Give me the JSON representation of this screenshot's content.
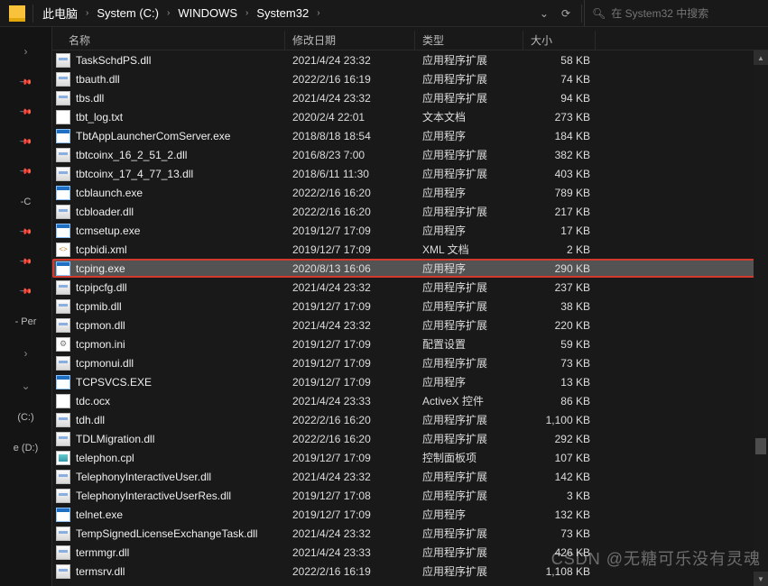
{
  "breadcrumb": [
    "此电脑",
    "System (C:)",
    "WINDOWS",
    "System32"
  ],
  "search": {
    "placeholder": "在 System32 中搜索"
  },
  "columns": {
    "name": "名称",
    "date": "修改日期",
    "type": "类型",
    "size": "大小"
  },
  "quick": {
    "c_label": "-C",
    "per_label": "- Per",
    "drives": [
      "(C:)",
      "e (D:)"
    ]
  },
  "selected_index": 11,
  "files": [
    {
      "name": "TaskSchdPS.dll",
      "date": "2021/4/24 23:32",
      "type": "应用程序扩展",
      "size": "58 KB",
      "icon": "dll"
    },
    {
      "name": "tbauth.dll",
      "date": "2022/2/16 16:19",
      "type": "应用程序扩展",
      "size": "74 KB",
      "icon": "dll"
    },
    {
      "name": "tbs.dll",
      "date": "2021/4/24 23:32",
      "type": "应用程序扩展",
      "size": "94 KB",
      "icon": "dll"
    },
    {
      "name": "tbt_log.txt",
      "date": "2020/2/4 22:01",
      "type": "文本文档",
      "size": "273 KB",
      "icon": "txt"
    },
    {
      "name": "TbtAppLauncherComServer.exe",
      "date": "2018/8/18 18:54",
      "type": "应用程序",
      "size": "184 KB",
      "icon": "exe"
    },
    {
      "name": "tbtcoinx_16_2_51_2.dll",
      "date": "2016/8/23 7:00",
      "type": "应用程序扩展",
      "size": "382 KB",
      "icon": "dll"
    },
    {
      "name": "tbtcoinx_17_4_77_13.dll",
      "date": "2018/6/11 11:30",
      "type": "应用程序扩展",
      "size": "403 KB",
      "icon": "dll"
    },
    {
      "name": "tcblaunch.exe",
      "date": "2022/2/16 16:20",
      "type": "应用程序",
      "size": "789 KB",
      "icon": "exe"
    },
    {
      "name": "tcbloader.dll",
      "date": "2022/2/16 16:20",
      "type": "应用程序扩展",
      "size": "217 KB",
      "icon": "dll"
    },
    {
      "name": "tcmsetup.exe",
      "date": "2019/12/7 17:09",
      "type": "应用程序",
      "size": "17 KB",
      "icon": "exe"
    },
    {
      "name": "tcpbidi.xml",
      "date": "2019/12/7 17:09",
      "type": "XML 文档",
      "size": "2 KB",
      "icon": "xml"
    },
    {
      "name": "tcping.exe",
      "date": "2020/8/13 16:06",
      "type": "应用程序",
      "size": "290 KB",
      "icon": "exe"
    },
    {
      "name": "tcpipcfg.dll",
      "date": "2021/4/24 23:32",
      "type": "应用程序扩展",
      "size": "237 KB",
      "icon": "dll"
    },
    {
      "name": "tcpmib.dll",
      "date": "2019/12/7 17:09",
      "type": "应用程序扩展",
      "size": "38 KB",
      "icon": "dll"
    },
    {
      "name": "tcpmon.dll",
      "date": "2021/4/24 23:32",
      "type": "应用程序扩展",
      "size": "220 KB",
      "icon": "dll"
    },
    {
      "name": "tcpmon.ini",
      "date": "2019/12/7 17:09",
      "type": "配置设置",
      "size": "59 KB",
      "icon": "ini"
    },
    {
      "name": "tcpmonui.dll",
      "date": "2019/12/7 17:09",
      "type": "应用程序扩展",
      "size": "73 KB",
      "icon": "dll"
    },
    {
      "name": "TCPSVCS.EXE",
      "date": "2019/12/7 17:09",
      "type": "应用程序",
      "size": "13 KB",
      "icon": "exe"
    },
    {
      "name": "tdc.ocx",
      "date": "2021/4/24 23:33",
      "type": "ActiveX 控件",
      "size": "86 KB",
      "icon": "ocx"
    },
    {
      "name": "tdh.dll",
      "date": "2022/2/16 16:20",
      "type": "应用程序扩展",
      "size": "1,100 KB",
      "icon": "dll"
    },
    {
      "name": "TDLMigration.dll",
      "date": "2022/2/16 16:20",
      "type": "应用程序扩展",
      "size": "292 KB",
      "icon": "dll"
    },
    {
      "name": "telephon.cpl",
      "date": "2019/12/7 17:09",
      "type": "控制面板项",
      "size": "107 KB",
      "icon": "cpl"
    },
    {
      "name": "TelephonyInteractiveUser.dll",
      "date": "2021/4/24 23:32",
      "type": "应用程序扩展",
      "size": "142 KB",
      "icon": "dll"
    },
    {
      "name": "TelephonyInteractiveUserRes.dll",
      "date": "2019/12/7 17:08",
      "type": "应用程序扩展",
      "size": "3 KB",
      "icon": "dll"
    },
    {
      "name": "telnet.exe",
      "date": "2019/12/7 17:09",
      "type": "应用程序",
      "size": "132 KB",
      "icon": "exe"
    },
    {
      "name": "TempSignedLicenseExchangeTask.dll",
      "date": "2021/4/24 23:32",
      "type": "应用程序扩展",
      "size": "73 KB",
      "icon": "dll"
    },
    {
      "name": "termmgr.dll",
      "date": "2021/4/24 23:33",
      "type": "应用程序扩展",
      "size": "426 KB",
      "icon": "dll"
    },
    {
      "name": "termsrv.dll",
      "date": "2022/2/16 16:19",
      "type": "应用程序扩展",
      "size": "1,108 KB",
      "icon": "dll"
    }
  ],
  "watermark": "CSDN @无糖可乐没有灵魂"
}
